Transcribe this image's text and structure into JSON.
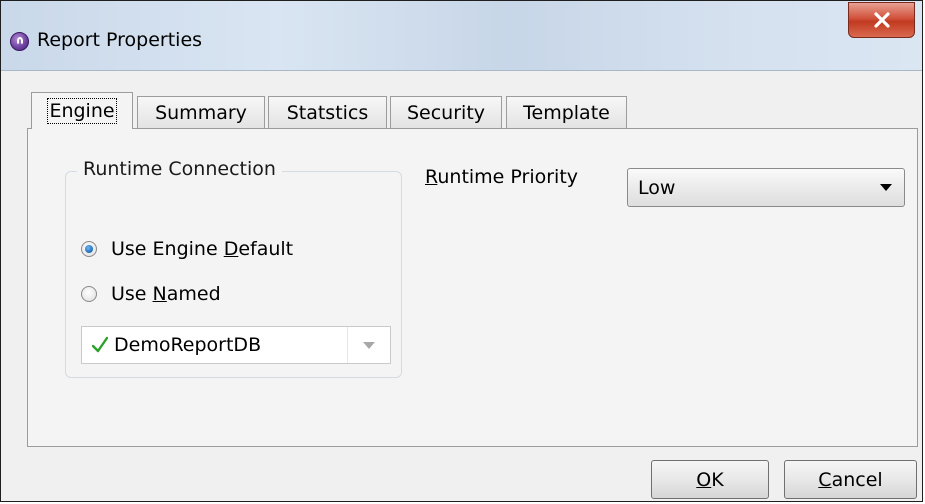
{
  "window": {
    "title": "Report Properties"
  },
  "tabs": [
    {
      "label": "Engine",
      "active": true
    },
    {
      "label": "Summary",
      "active": false
    },
    {
      "label": "Statstics",
      "active": false
    },
    {
      "label": "Security",
      "active": false
    },
    {
      "label": "Template",
      "active": false
    }
  ],
  "runtime_connection": {
    "group_title": "Runtime Connection",
    "use_default": {
      "prefix": "Use Engine ",
      "mnemonic": "D",
      "suffix": "efault",
      "checked": true
    },
    "use_named": {
      "prefix": "Use ",
      "mnemonic": "N",
      "suffix": "amed",
      "checked": false
    },
    "named_value": "DemoReportDB",
    "check_icon": "check-icon"
  },
  "runtime_priority": {
    "label_mnemonic": "R",
    "label_rest": "untime Priority",
    "selected": "Low"
  },
  "buttons": {
    "ok_mnemonic": "O",
    "ok_rest": "K",
    "cancel_mnemonic": "C",
    "cancel_rest": "ancel"
  },
  "colors": {
    "check": "#2aa12a",
    "radio_selected": "#1a6bb8",
    "close_button": "#c13a20"
  }
}
